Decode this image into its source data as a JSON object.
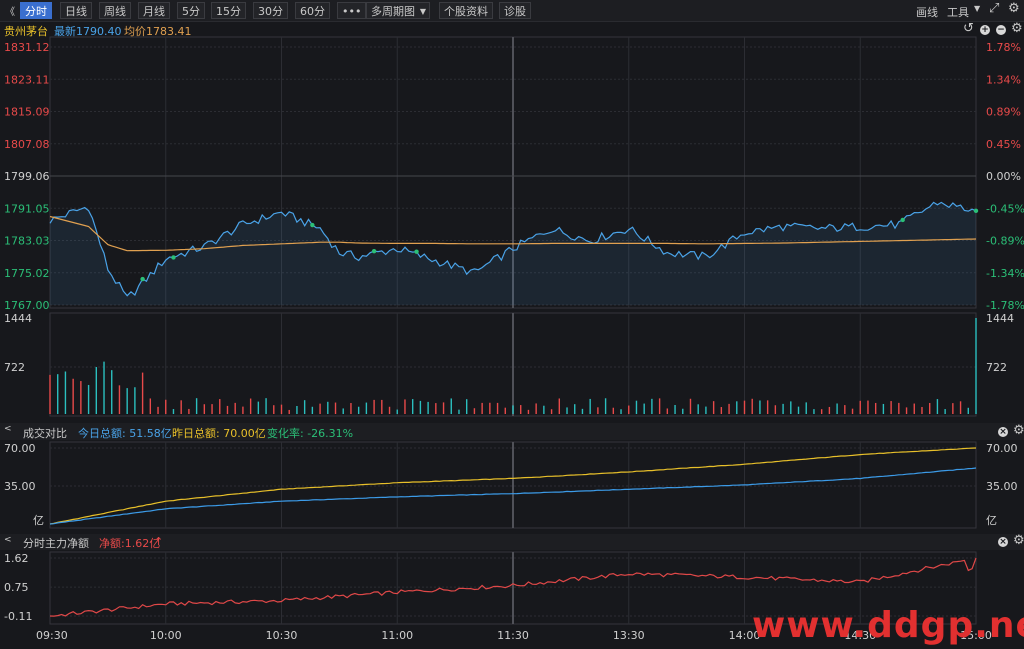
{
  "toolbar": {
    "back_glyph": "《",
    "items": [
      "分时",
      "日线",
      "周线",
      "月线",
      "5分",
      "15分",
      "30分",
      "60分",
      "•••",
      "多周期图",
      "个股资料",
      "诊股"
    ],
    "right": [
      "画线",
      "工具"
    ]
  },
  "stock": {
    "name": "贵州茅台",
    "latest_label": "最新1790.40",
    "avg_label": "均价1783.41"
  },
  "price_axis": {
    "left": [
      "1831.12",
      "1823.11",
      "1815.09",
      "1807.08",
      "1799.06",
      "1791.05",
      "1783.03",
      "1775.02",
      "1767.00"
    ],
    "right": [
      "1.78%",
      "1.34%",
      "0.89%",
      "0.45%",
      "0.00%",
      "-0.45%",
      "-0.89%",
      "-1.34%",
      "-1.78%"
    ]
  },
  "volume_axis": {
    "left": [
      "1444",
      "722"
    ],
    "right": [
      "1444",
      "722"
    ]
  },
  "turnover_panel": {
    "title": "成交对比",
    "today": "今日总额: 51.58亿",
    "yesterday": "昨日总额: 70.00亿",
    "change": "变化率: -26.31%",
    "left_ticks": [
      "70.00",
      "35.00",
      "亿"
    ],
    "right_ticks": [
      "70.00",
      "35.00",
      "亿"
    ]
  },
  "flow_panel": {
    "title": "分时主力净额",
    "net": "净额:1.62亿",
    "arrow": "↑",
    "ticks": [
      "1.62",
      "0.75",
      "-0.11"
    ]
  },
  "time_axis": [
    "09:30",
    "10:00",
    "10:30",
    "11:00",
    "11:30",
    "13:30",
    "14:00",
    "14:30",
    "15:00"
  ],
  "watermark": "www.ddgp.net",
  "colors": {
    "up": "#e84a4a",
    "down": "#2bbf77",
    "price": "#4aa3e8",
    "avg": "#e0a050",
    "yesterday": "#e8c02a",
    "today": "#3c9be8",
    "flow": "#e04848"
  },
  "chart_data": [
    {
      "type": "line",
      "title": "贵州茅台",
      "x": [
        "09:30",
        "09:40",
        "09:45",
        "09:50",
        "10:00",
        "10:10",
        "10:20",
        "10:30",
        "10:40",
        "10:45",
        "10:50",
        "11:00",
        "11:10",
        "11:20",
        "11:30",
        "13:10",
        "13:20",
        "13:30",
        "13:40",
        "13:50",
        "14:00",
        "14:10",
        "14:20",
        "14:30",
        "14:40",
        "14:50",
        "15:00"
      ],
      "series": [
        {
          "name": "最新",
          "values": [
            1788.0,
            1791.5,
            1776.0,
            1768.5,
            1778.5,
            1781.5,
            1787.0,
            1790.0,
            1786.0,
            1780.0,
            1779.0,
            1781.0,
            1778.0,
            1775.0,
            1781.0,
            1786.0,
            1783.0,
            1786.0,
            1780.0,
            1779.0,
            1785.0,
            1786.5,
            1786.0,
            1786.5,
            1787.0,
            1792.5,
            1790.4
          ]
        },
        {
          "name": "均价",
          "values": [
            1789.0,
            1786.5,
            1782.0,
            1780.5,
            1780.6,
            1781.0,
            1781.8,
            1782.2,
            1782.6,
            1782.6,
            1782.4,
            1782.3,
            1782.3,
            1782.2,
            1782.2,
            1782.3,
            1782.3,
            1782.3,
            1782.3,
            1782.2,
            1782.3,
            1782.4,
            1782.6,
            1782.8,
            1783.0,
            1783.2,
            1783.41
          ]
        }
      ],
      "ylim": [
        1767.0,
        1831.12
      ],
      "grid": true
    },
    {
      "type": "line",
      "title": "成交对比",
      "x": [
        "09:30",
        "10:00",
        "10:30",
        "11:00",
        "11:30",
        "13:30",
        "14:00",
        "14:30",
        "15:00"
      ],
      "series": [
        {
          "name": "昨日总额",
          "values": [
            0,
            21,
            32,
            38,
            42,
            48,
            55,
            64,
            70.0
          ]
        },
        {
          "name": "今日总额",
          "values": [
            0,
            14,
            21,
            25,
            28,
            32,
            36,
            42,
            51.58
          ]
        }
      ],
      "ylim": [
        0,
        70.0
      ]
    },
    {
      "type": "line",
      "title": "分时主力净额",
      "x": [
        "09:30",
        "10:00",
        "10:30",
        "11:00",
        "11:30",
        "13:30",
        "14:00",
        "14:30",
        "15:00"
      ],
      "values": [
        -0.11,
        0.25,
        0.35,
        0.6,
        0.8,
        1.15,
        1.05,
        0.9,
        1.62
      ],
      "ylim": [
        -0.11,
        1.62
      ]
    }
  ]
}
